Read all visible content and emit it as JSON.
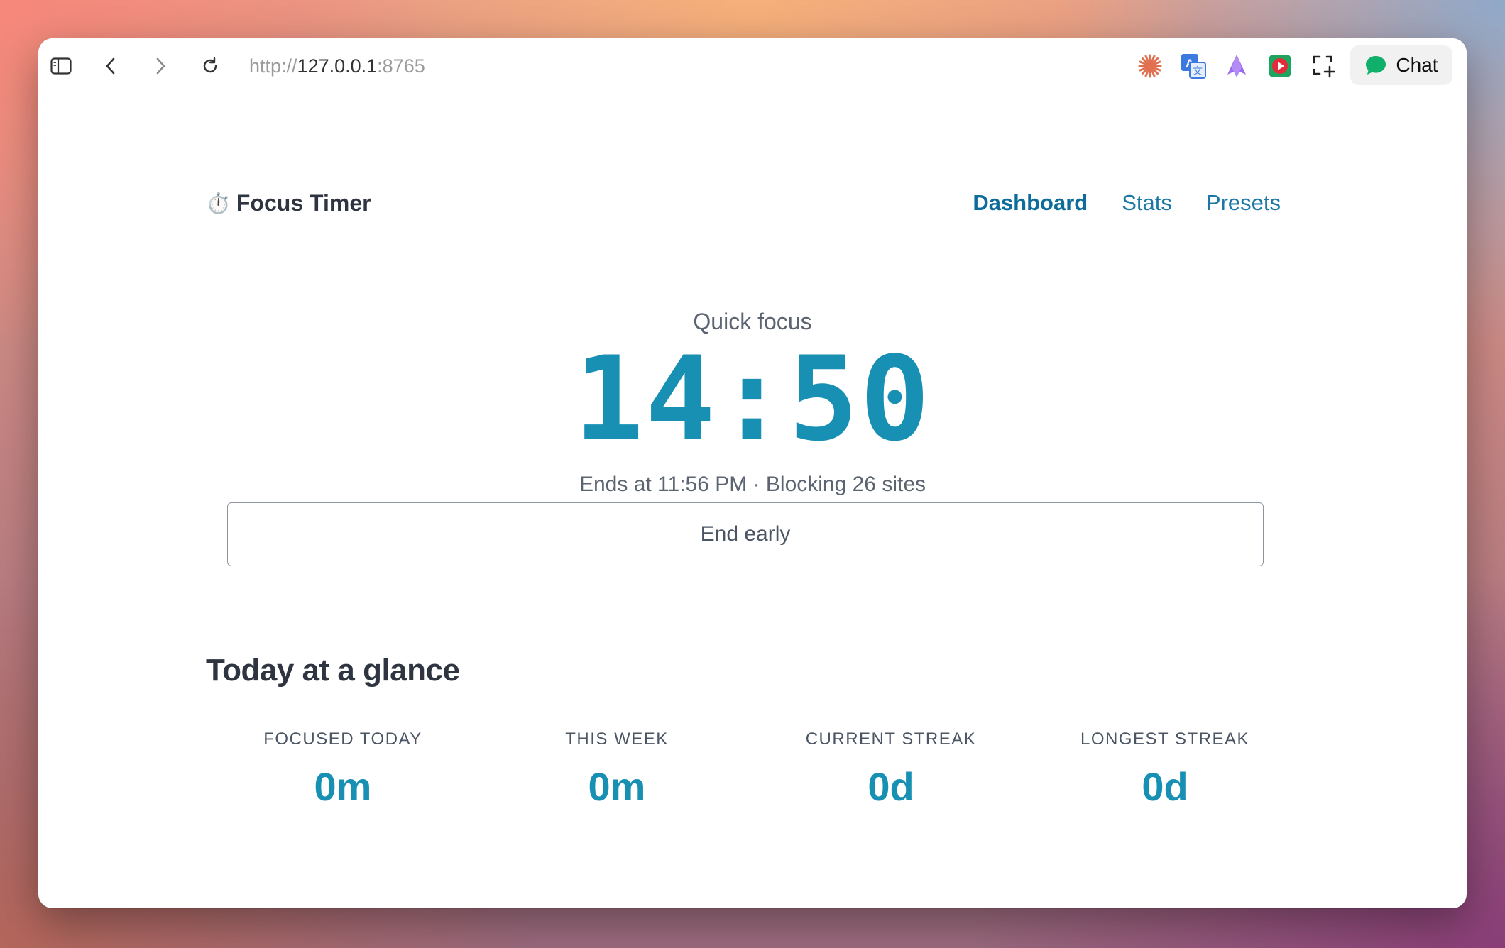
{
  "browser": {
    "url_scheme": "http://",
    "url_host": "127.0.0.1",
    "url_port": ":8765",
    "chat_label": "Chat",
    "extensions": [
      "claude-icon",
      "translate-icon",
      "ai-extension-icon",
      "video-extension-icon",
      "screenshot-icon"
    ]
  },
  "app": {
    "brand_icon": "⏱️",
    "brand_name": "Focus Timer",
    "nav": [
      {
        "label": "Dashboard",
        "active": true
      },
      {
        "label": "Stats",
        "active": false
      },
      {
        "label": "Presets",
        "active": false
      }
    ]
  },
  "session": {
    "mode_label": "Quick focus",
    "time_remaining": "14:50",
    "details": "Ends at 11:56 PM · Blocking 26 sites",
    "end_button_label": "End early"
  },
  "glance": {
    "title": "Today at a glance",
    "stats": [
      {
        "label": "FOCUSED TODAY",
        "value": "0m"
      },
      {
        "label": "THIS WEEK",
        "value": "0m"
      },
      {
        "label": "CURRENT STREAK",
        "value": "0d"
      },
      {
        "label": "LONGEST STREAK",
        "value": "0d"
      }
    ]
  },
  "colors": {
    "accent": "#1890b4",
    "nav_link": "#1b78a6",
    "heading": "#2f3540"
  }
}
